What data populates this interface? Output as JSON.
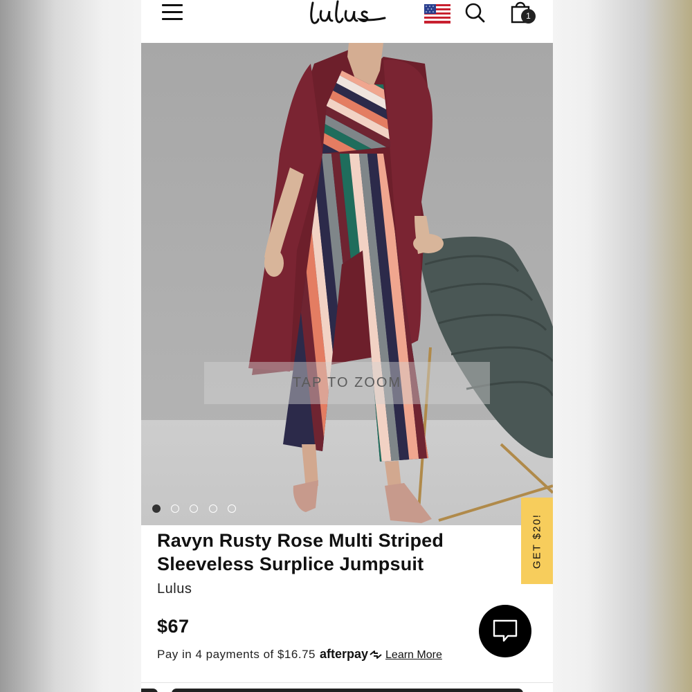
{
  "header": {
    "menu_icon": "hamburger-menu-icon",
    "logo_text": "Lulus",
    "flag_icon": "us-flag-icon",
    "search_icon": "search-icon",
    "bag_icon": "shopping-bag-icon",
    "cart_count": "1"
  },
  "gallery": {
    "zoom_hint": "TAP TO ZOOM",
    "active_index": 0,
    "total": 5
  },
  "product": {
    "title_line1": "Ravyn Rusty Rose Multi Striped",
    "title_line2": "Sleeveless Surplice Jumpsuit",
    "brand": "Lulus",
    "price": "$67",
    "installments_text": "Pay in 4 payments of $16.75",
    "afterpay_label": "afterpay",
    "learn_more": "Learn More"
  },
  "promo": {
    "tab_label": "GET $20!",
    "color": "#f7cd5c"
  },
  "chat": {
    "icon": "chat-bubble-icon"
  }
}
